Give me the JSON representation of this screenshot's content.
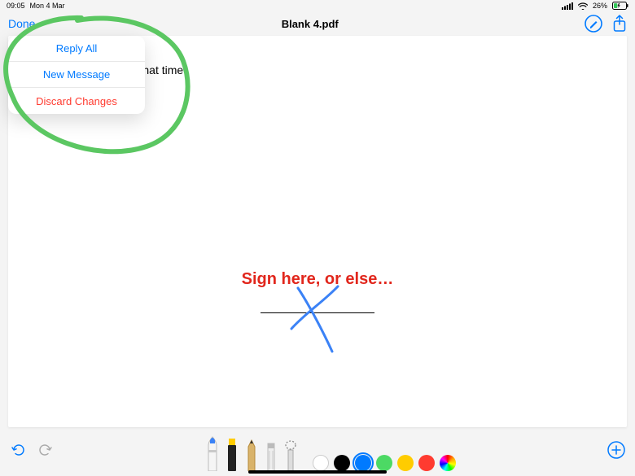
{
  "statusbar": {
    "time": "09:05",
    "date": "Mon 4 Mar",
    "battery_pct": "26%"
  },
  "navbar": {
    "done": "Done",
    "title": "Blank 4.pdf"
  },
  "popover": {
    "items": [
      {
        "label": "Reply All"
      },
      {
        "label": "New Message"
      },
      {
        "label": "Discard Changes"
      }
    ]
  },
  "document": {
    "body_text_fragment": "hatever it is you said that time.",
    "sign_text": "Sign here, or else…"
  },
  "colors": {
    "ios_blue": "#007aff",
    "ios_red": "#ff3b30",
    "annotation_green": "#5bc762",
    "annotation_blue": "#3b82f6",
    "swatches": [
      "#ffffff",
      "#000000",
      "#007aff",
      "#4cd964",
      "#ffcc00",
      "#ff3b30"
    ]
  },
  "toolbar": {
    "tools": [
      "pen",
      "marker",
      "pencil",
      "eraser",
      "lasso"
    ],
    "selected_color_index": 2
  }
}
